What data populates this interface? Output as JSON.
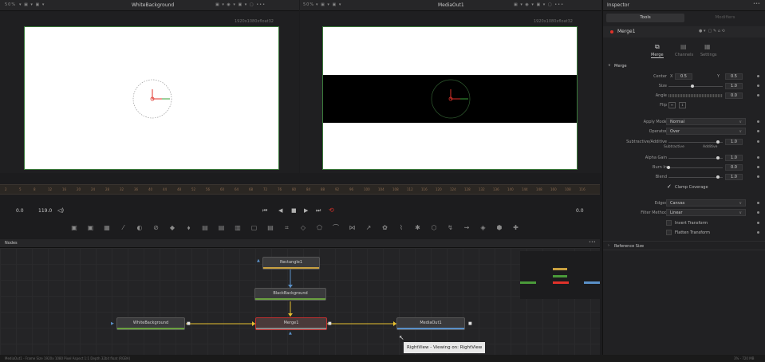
{
  "left_viewer": {
    "zoom": "50%",
    "title": "WhiteBackground",
    "resolution": "1920x1080xfloat32"
  },
  "right_viewer": {
    "zoom": "50%",
    "title": "MediaOut1",
    "resolution": "1920x1080xfloat32"
  },
  "ruler": {
    "ticks": [
      "2",
      "5",
      "8",
      "12",
      "16",
      "20",
      "24",
      "28",
      "32",
      "36",
      "40",
      "44",
      "48",
      "52",
      "56",
      "60",
      "64",
      "68",
      "72",
      "76",
      "80",
      "84",
      "88",
      "92",
      "96",
      "100",
      "104",
      "108",
      "112",
      "116",
      "120",
      "124",
      "128",
      "132",
      "136",
      "140",
      "144",
      "148",
      "160",
      "108",
      "116"
    ]
  },
  "transport": {
    "start": "0.0",
    "end": "119.0",
    "current": "0.0"
  },
  "nodes_panel": {
    "title": "Nodes",
    "more": "•••"
  },
  "nodes": {
    "rectangle": "Rectangle1",
    "black_background": "BlackBackground",
    "white_background": "WhiteBackground",
    "merge": "Merge1",
    "media_out": "MediaOut1"
  },
  "tooltip": "RightView - Viewing on: RightView",
  "status_text": "MediaOut1 - Frame Size 1920x 1080 Pixel Aspect 1:1 Depth 32bit float (RGBA)",
  "status_right": "3% - 720 MB",
  "inspector": {
    "title": "Inspector",
    "more": "•••",
    "tabs": [
      "Tools",
      "Modifiers"
    ],
    "node_name": "Merge1",
    "subtabs": [
      "Merge",
      "Channels",
      "Settings"
    ],
    "section": "Merge",
    "params": {
      "center_label": "Center",
      "center_x_label": "X",
      "center_x": "0.5",
      "center_y_label": "Y",
      "center_y": "0.5",
      "size_label": "Size",
      "size": "1.0",
      "angle_label": "Angle",
      "angle": "0.0",
      "flip_label": "Flip",
      "apply_mode_label": "Apply Mode",
      "apply_mode": "Normal",
      "operator_label": "Operator",
      "operator": "Over",
      "sub_add_label": "Subtractive/Additive",
      "sub_add": "1.0",
      "subtractive": "Subtractive",
      "additive": "Additive",
      "alpha_gain_label": "Alpha Gain",
      "alpha_gain": "1.0",
      "burn_in_label": "Burn In",
      "burn_in": "0.0",
      "blend_label": "Blend",
      "blend": "1.0",
      "clamp_label": "Clamp Coverage",
      "edges_label": "Edges",
      "edges": "Canvas",
      "filter_label": "Filter Method",
      "filter": "Linear",
      "invert_label": "Invert Transform",
      "flatten_label": "Flatten Transform"
    },
    "reference_size": "Reference Size"
  },
  "colors": {
    "accent_red": "#e0322a",
    "green": "#4a9a3a",
    "yellow": "#e8c030",
    "blue": "#5a90c8"
  }
}
